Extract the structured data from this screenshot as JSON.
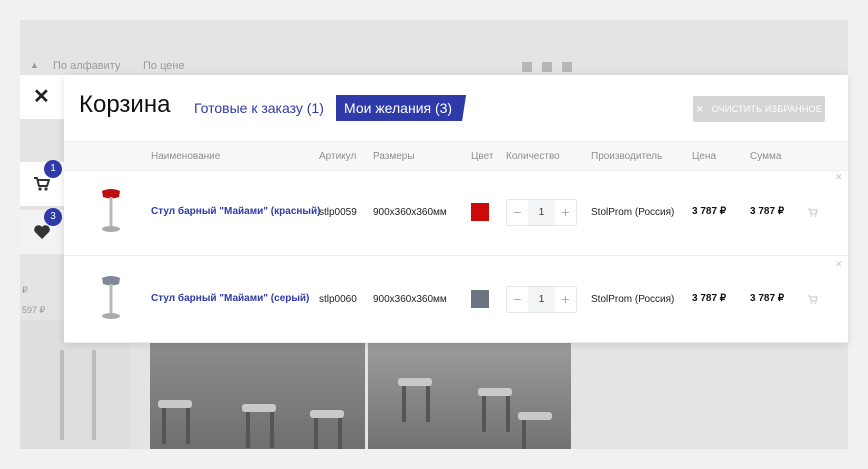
{
  "background": {
    "sort_label": "По алфавиту",
    "sort_price": "По цене",
    "price_fragment_1": "₽",
    "price_fragment_2": "597 ₽"
  },
  "side_tabs": {
    "cart_count": "1",
    "wish_count": "3"
  },
  "modal": {
    "title": "Корзина",
    "tab_ready": "Готовые к заказу (1)",
    "tab_wishlist": "Мои желания (3)",
    "clear_button": "ОЧИСТИТЬ ИЗБРАННОЕ",
    "columns": [
      "Наименование",
      "Артикул",
      "Размеры",
      "Цвет",
      "Количество",
      "Производитель",
      "Цена",
      "Сумма"
    ],
    "items": [
      {
        "name": "Стул барный \"Майами\" (красный)",
        "article": "stlp0059",
        "size": "900х360х360мм",
        "color": "#cc0a0a",
        "qty": "1",
        "maker": "StolProm (Россия)",
        "price": "3 787 ₽",
        "sum": "3 787 ₽"
      },
      {
        "name": "Стул барный \"Майами\" (серый)",
        "article": "stlp0060",
        "size": "900х360х360мм",
        "color": "#6f7580",
        "qty": "1",
        "maker": "StolProm (Россия)",
        "price": "3 787 ₽",
        "sum": "3 787 ₽"
      }
    ]
  },
  "colors": {
    "accent": "#2e3aa8",
    "clear_button_bg": "#d5d5d5"
  }
}
